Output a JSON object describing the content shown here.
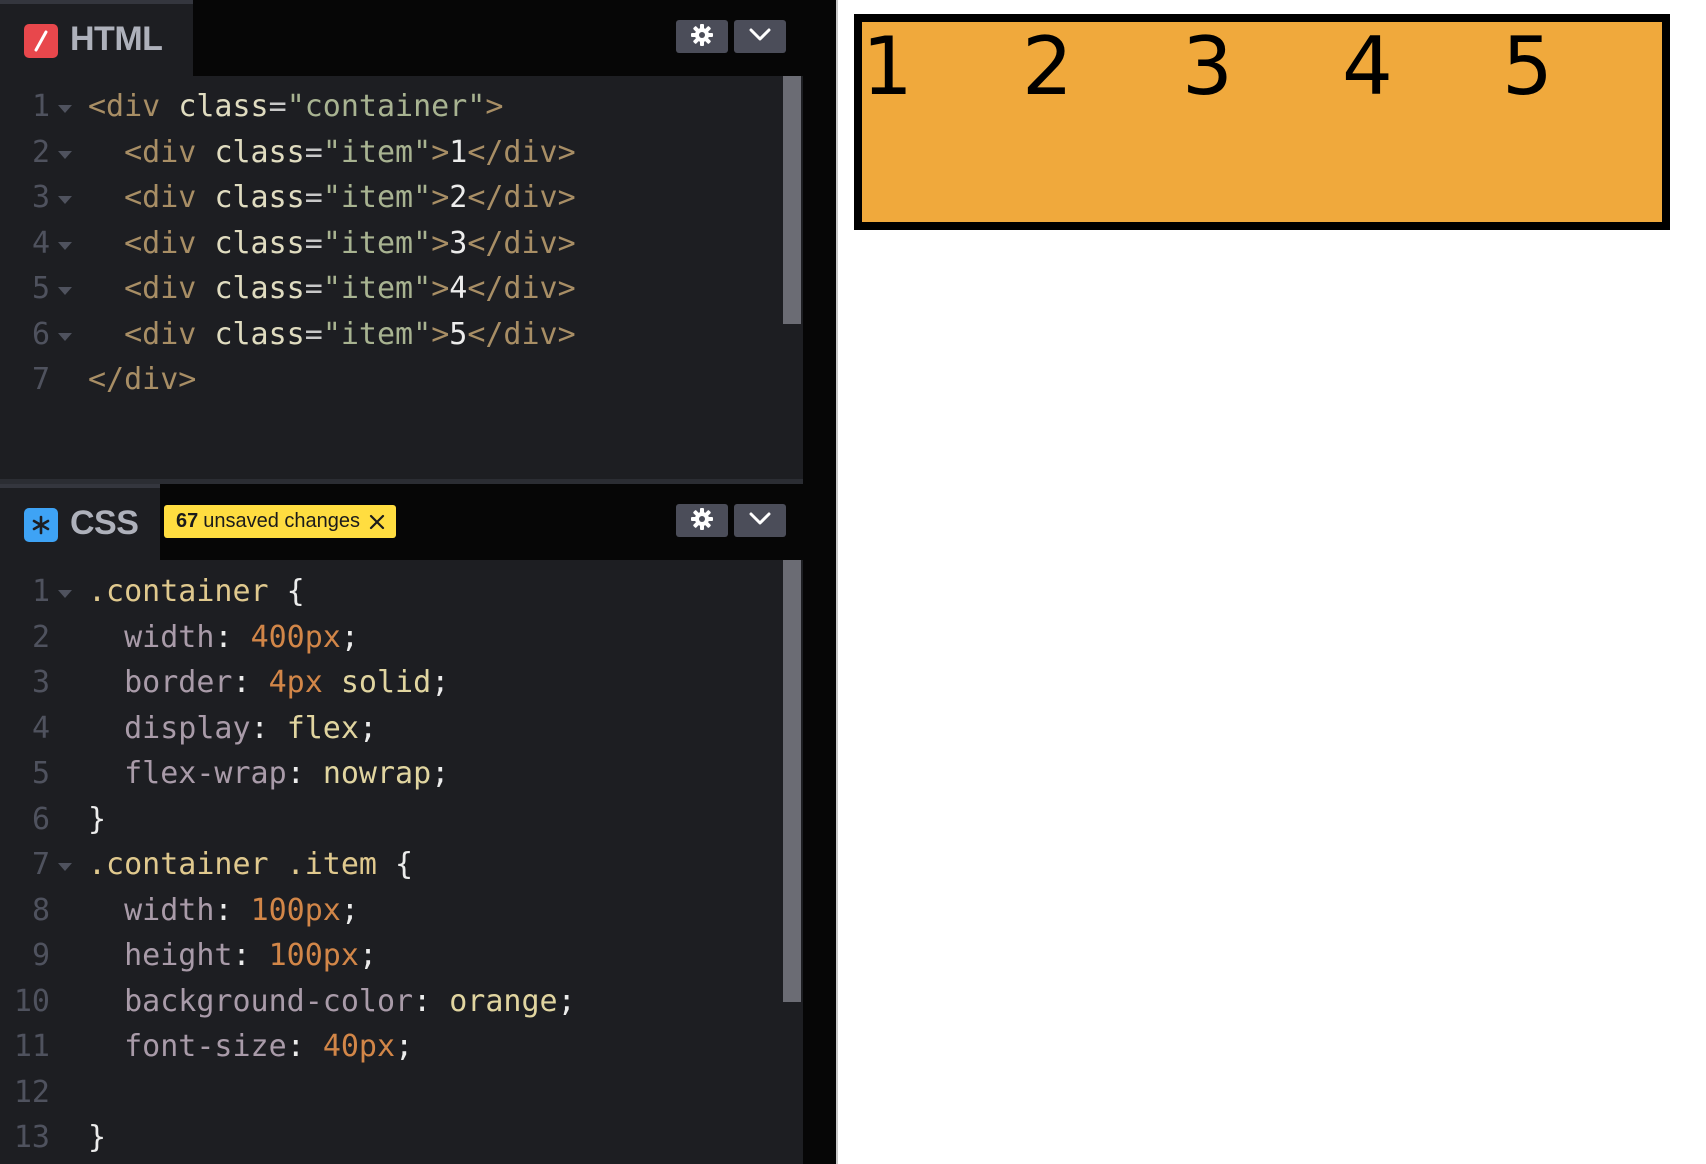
{
  "html_panel": {
    "label": "HTML",
    "icon": "slash-icon",
    "icon_color": "#e8474c",
    "lines": [
      {
        "num": "1",
        "fold": true,
        "tokens": [
          {
            "t": "<div ",
            "c": "tag"
          },
          {
            "t": "class",
            "c": "attr"
          },
          {
            "t": "=",
            "c": "eq"
          },
          {
            "t": "\"container\"",
            "c": "str"
          },
          {
            "t": ">",
            "c": "tag"
          }
        ]
      },
      {
        "num": "2",
        "fold": true,
        "tokens": [
          {
            "t": "  <div ",
            "c": "tag"
          },
          {
            "t": "class",
            "c": "attr"
          },
          {
            "t": "=",
            "c": "eq"
          },
          {
            "t": "\"item\"",
            "c": "str"
          },
          {
            "t": ">",
            "c": "tag"
          },
          {
            "t": "1",
            "c": "txt"
          },
          {
            "t": "</div>",
            "c": "tag"
          }
        ]
      },
      {
        "num": "3",
        "fold": true,
        "tokens": [
          {
            "t": "  <div ",
            "c": "tag"
          },
          {
            "t": "class",
            "c": "attr"
          },
          {
            "t": "=",
            "c": "eq"
          },
          {
            "t": "\"item\"",
            "c": "str"
          },
          {
            "t": ">",
            "c": "tag"
          },
          {
            "t": "2",
            "c": "txt"
          },
          {
            "t": "</div>",
            "c": "tag"
          }
        ]
      },
      {
        "num": "4",
        "fold": true,
        "tokens": [
          {
            "t": "  <div ",
            "c": "tag"
          },
          {
            "t": "class",
            "c": "attr"
          },
          {
            "t": "=",
            "c": "eq"
          },
          {
            "t": "\"item\"",
            "c": "str"
          },
          {
            "t": ">",
            "c": "tag"
          },
          {
            "t": "3",
            "c": "txt"
          },
          {
            "t": "</div>",
            "c": "tag"
          }
        ]
      },
      {
        "num": "5",
        "fold": true,
        "tokens": [
          {
            "t": "  <div ",
            "c": "tag"
          },
          {
            "t": "class",
            "c": "attr"
          },
          {
            "t": "=",
            "c": "eq"
          },
          {
            "t": "\"item\"",
            "c": "str"
          },
          {
            "t": ">",
            "c": "tag"
          },
          {
            "t": "4",
            "c": "txt"
          },
          {
            "t": "</div>",
            "c": "tag"
          }
        ]
      },
      {
        "num": "6",
        "fold": true,
        "tokens": [
          {
            "t": "  <div ",
            "c": "tag"
          },
          {
            "t": "class",
            "c": "attr"
          },
          {
            "t": "=",
            "c": "eq"
          },
          {
            "t": "\"item\"",
            "c": "str"
          },
          {
            "t": ">",
            "c": "tag"
          },
          {
            "t": "5",
            "c": "txt"
          },
          {
            "t": "</div>",
            "c": "tag"
          }
        ]
      },
      {
        "num": "7",
        "fold": false,
        "tokens": [
          {
            "t": "</div>",
            "c": "tag"
          }
        ]
      }
    ]
  },
  "css_panel": {
    "label": "CSS",
    "icon": "asterisk-icon",
    "icon_color": "#3ea3f5",
    "unsaved_count": "67",
    "unsaved_text": "unsaved changes",
    "lines": [
      {
        "num": "1",
        "fold": true,
        "tokens": [
          {
            "t": ".container",
            "c": "sel"
          },
          {
            "t": " {",
            "c": "pun"
          }
        ]
      },
      {
        "num": "2",
        "fold": false,
        "tokens": [
          {
            "t": "  width",
            "c": "prop"
          },
          {
            "t": ": ",
            "c": "pun"
          },
          {
            "t": "400px",
            "c": "num"
          },
          {
            "t": ";",
            "c": "pun"
          }
        ]
      },
      {
        "num": "3",
        "fold": false,
        "tokens": [
          {
            "t": "  border",
            "c": "prop"
          },
          {
            "t": ": ",
            "c": "pun"
          },
          {
            "t": "4px",
            "c": "num"
          },
          {
            "t": " solid",
            "c": "kw"
          },
          {
            "t": ";",
            "c": "pun"
          }
        ]
      },
      {
        "num": "4",
        "fold": false,
        "tokens": [
          {
            "t": "  display",
            "c": "prop"
          },
          {
            "t": ": ",
            "c": "pun"
          },
          {
            "t": "flex",
            "c": "kw"
          },
          {
            "t": ";",
            "c": "pun"
          }
        ]
      },
      {
        "num": "5",
        "fold": false,
        "tokens": [
          {
            "t": "  flex-wrap",
            "c": "prop"
          },
          {
            "t": ": ",
            "c": "pun"
          },
          {
            "t": "nowrap",
            "c": "kw"
          },
          {
            "t": ";",
            "c": "pun"
          }
        ]
      },
      {
        "num": "6",
        "fold": false,
        "tokens": [
          {
            "t": "}",
            "c": "pun"
          }
        ]
      },
      {
        "num": "7",
        "fold": true,
        "tokens": [
          {
            "t": ".container .item",
            "c": "sel"
          },
          {
            "t": " {",
            "c": "pun"
          }
        ]
      },
      {
        "num": "8",
        "fold": false,
        "tokens": [
          {
            "t": "  width",
            "c": "prop"
          },
          {
            "t": ": ",
            "c": "pun"
          },
          {
            "t": "100px",
            "c": "num"
          },
          {
            "t": ";",
            "c": "pun"
          }
        ]
      },
      {
        "num": "9",
        "fold": false,
        "tokens": [
          {
            "t": "  height",
            "c": "prop"
          },
          {
            "t": ": ",
            "c": "pun"
          },
          {
            "t": "100px",
            "c": "num"
          },
          {
            "t": ";",
            "c": "pun"
          }
        ]
      },
      {
        "num": "10",
        "fold": false,
        "tokens": [
          {
            "t": "  background-color",
            "c": "prop"
          },
          {
            "t": ": ",
            "c": "pun"
          },
          {
            "t": "orange",
            "c": "kw"
          },
          {
            "t": ";",
            "c": "pun"
          }
        ]
      },
      {
        "num": "11",
        "fold": false,
        "tokens": [
          {
            "t": "  font-size",
            "c": "prop"
          },
          {
            "t": ": ",
            "c": "pun"
          },
          {
            "t": "40px",
            "c": "num"
          },
          {
            "t": ";",
            "c": "pun"
          }
        ]
      },
      {
        "num": "12",
        "fold": false,
        "tokens": []
      },
      {
        "num": "13",
        "fold": false,
        "tokens": [
          {
            "t": "}",
            "c": "pun"
          }
        ]
      }
    ]
  },
  "preview": {
    "items": [
      "1",
      "2",
      "3",
      "4",
      "5"
    ],
    "item_color": "#f0a93c",
    "border_color": "#000000"
  }
}
